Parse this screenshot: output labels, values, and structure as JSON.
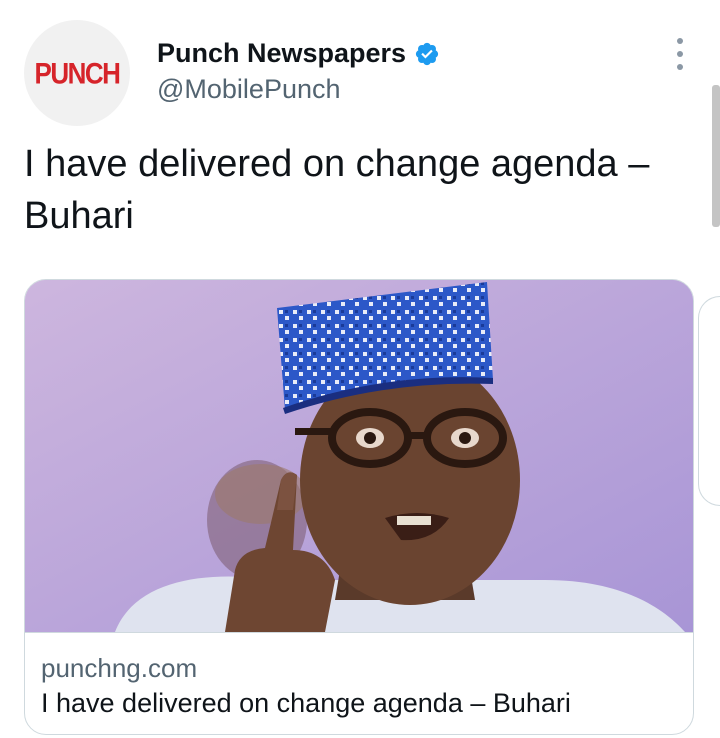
{
  "author": {
    "logo_text": "PUNCH",
    "name": "Punch Newspapers",
    "handle": "@MobilePunch",
    "verified_icon": "verified-badge-icon"
  },
  "tweet": {
    "text": "I have delivered on change agenda – Buhari"
  },
  "card": {
    "image_alt": "photo of man in patterned cap and glasses pointing finger",
    "domain": "punchng.com",
    "title": "I have delivered on change agenda – Buhari"
  },
  "colors": {
    "verified": "#1d9bf0",
    "logo_red": "#d6242a",
    "secondary_text": "#536471"
  }
}
